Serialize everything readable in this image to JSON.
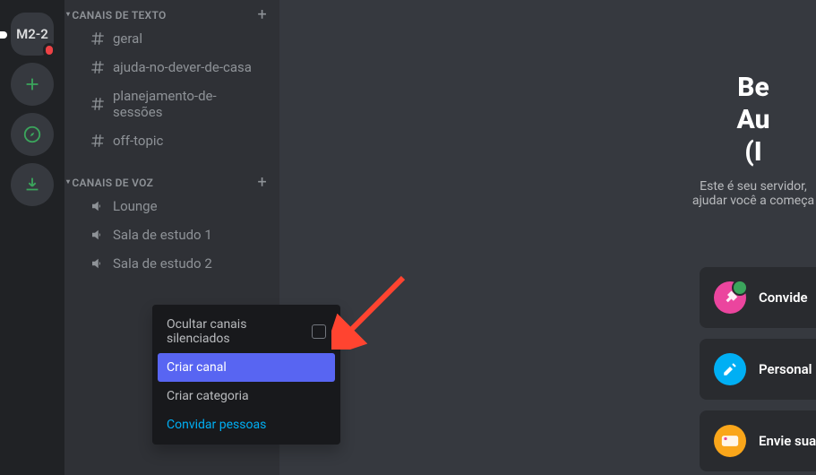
{
  "guilds": {
    "server_initials": "M2-2"
  },
  "categories": {
    "text": {
      "label": "CANAIS DE TEXTO"
    },
    "voice": {
      "label": "CANAIS DE VOZ"
    }
  },
  "text_channels": [
    {
      "name": "geral"
    },
    {
      "name": "ajuda-no-dever-de-casa"
    },
    {
      "name": "planejamento-de-sessões"
    },
    {
      "name": "off-topic"
    }
  ],
  "voice_channels": [
    {
      "name": "Lounge"
    },
    {
      "name": "Sala de estudo 1"
    },
    {
      "name": "Sala de estudo 2"
    }
  ],
  "context_menu": {
    "mute": "Ocultar canais silenciados",
    "create_channel": "Criar canal",
    "create_category": "Criar categoria",
    "invite": "Convidar pessoas"
  },
  "welcome": {
    "heading": "Be\nAu\n(I",
    "sub": "Este é seu servidor,\najudar você a começa"
  },
  "cards": {
    "invite": "Convide",
    "personalize": "Personal",
    "send": "Envie sua"
  }
}
